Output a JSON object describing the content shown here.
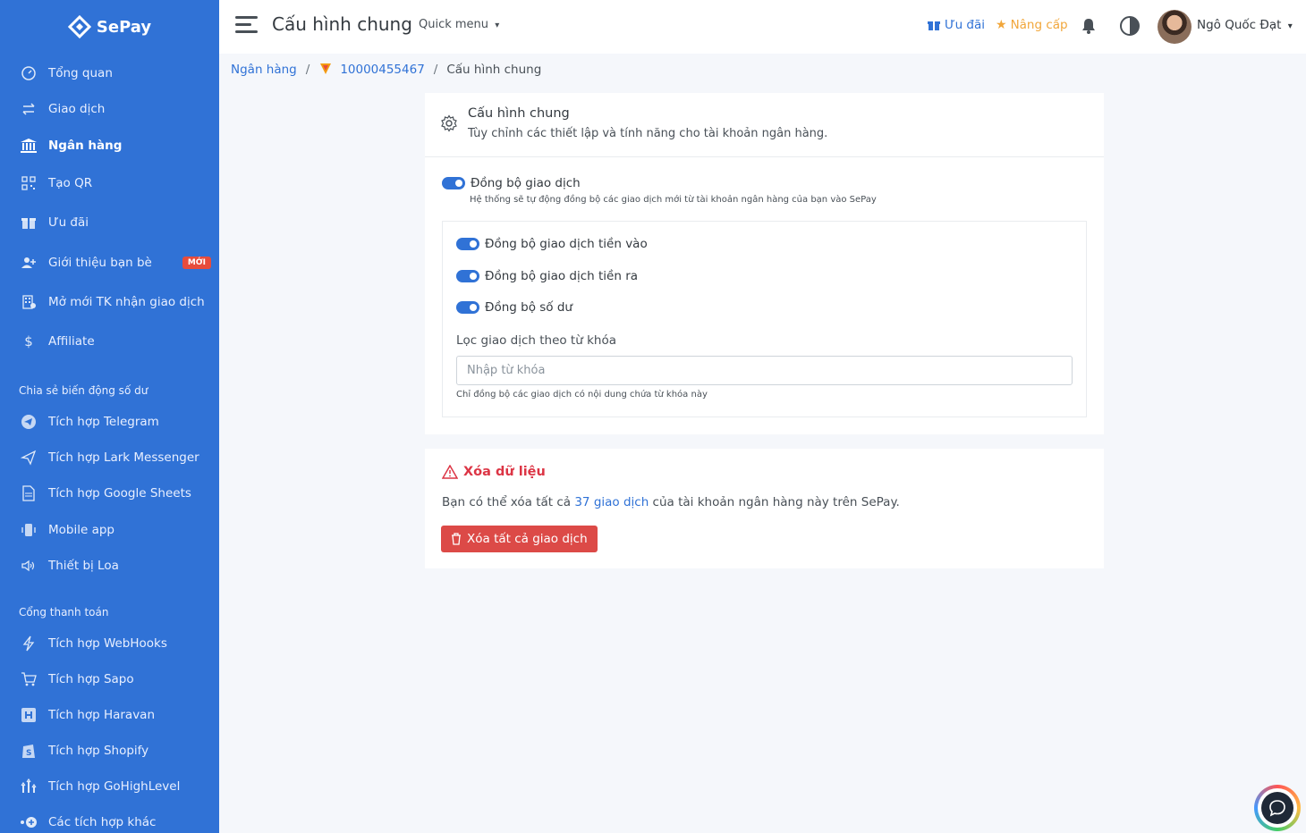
{
  "brand": {
    "name": "SePay"
  },
  "sidebar": {
    "items": [
      {
        "label": "Tổng quan",
        "icon": "dashboard-icon"
      },
      {
        "label": "Giao dịch",
        "icon": "transfer-icon"
      },
      {
        "label": "Ngân hàng",
        "icon": "bank-icon",
        "active": true
      },
      {
        "label": "Tạo QR",
        "icon": "qr-icon"
      },
      {
        "label": "Ưu đãi",
        "icon": "gift-icon"
      },
      {
        "label": "Giới thiệu bạn bè",
        "icon": "user-plus-icon",
        "badge": "MỚI"
      },
      {
        "label": "Mở mới TK nhận giao dịch",
        "icon": "building-icon"
      },
      {
        "label": "Affiliate",
        "icon": "dollar-icon"
      }
    ],
    "section1": "Chia sẻ biến động số dư",
    "share_items": [
      {
        "label": "Tích hợp Telegram",
        "icon": "telegram-icon"
      },
      {
        "label": "Tích hợp Lark Messenger",
        "icon": "send-icon"
      },
      {
        "label": "Tích hợp Google Sheets",
        "icon": "sheet-icon"
      },
      {
        "label": "Mobile app",
        "icon": "mobile-icon"
      },
      {
        "label": "Thiết bị Loa",
        "icon": "speaker-icon"
      }
    ],
    "section2": "Cổng thanh toán",
    "payment_items": [
      {
        "label": "Tích hợp WebHooks",
        "icon": "lightning-icon"
      },
      {
        "label": "Tích hợp Sapo",
        "icon": "cart-icon"
      },
      {
        "label": "Tích hợp Haravan",
        "icon": "haravan-icon"
      },
      {
        "label": "Tích hợp Shopify",
        "icon": "shopify-icon"
      },
      {
        "label": "Tích hợp GoHighLevel",
        "icon": "gohighlevel-icon"
      },
      {
        "label": "Các tích hợp khác",
        "icon": "plus-circle-icon"
      }
    ]
  },
  "header": {
    "title": "Cấu hình chung",
    "quick_menu": "Quick menu",
    "uu_dai": "Ưu đãi",
    "nang_cap": "Nâng cấp",
    "user_name": "Ngô Quốc Đạt"
  },
  "breadcrumb": {
    "bank": "Ngân hàng",
    "account": "10000455467",
    "current": "Cấu hình chung"
  },
  "settings": {
    "title": "Cấu hình chung",
    "subtitle": "Tùy chỉnh các thiết lập và tính năng cho tài khoản ngân hàng.",
    "sync_label": "Đồng bộ giao dịch",
    "sync_help": "Hệ thống sẽ tự động đồng bộ các giao dịch mới từ tài khoản ngân hàng của bạn vào SePay",
    "sync_in": "Đồng bộ giao dịch tiền vào",
    "sync_out": "Đồng bộ giao dịch tiền ra",
    "sync_balance": "Đồng bộ số dư",
    "filter_label": "Lọc giao dịch theo từ khóa",
    "filter_placeholder": "Nhập từ khóa",
    "filter_help": "Chỉ đồng bộ các giao dịch có nội dung chứa từ khóa này"
  },
  "danger": {
    "title": "Xóa dữ liệu",
    "desc_before": "Bạn có thể xóa tất cả ",
    "desc_count": "37 giao dịch",
    "desc_after": " của tài khoản ngân hàng này trên SePay.",
    "button": "Xóa tất cả giao dịch"
  },
  "colors": {
    "primary": "#3072d6",
    "danger": "#dc4a47",
    "upgrade": "#f1a63a"
  }
}
